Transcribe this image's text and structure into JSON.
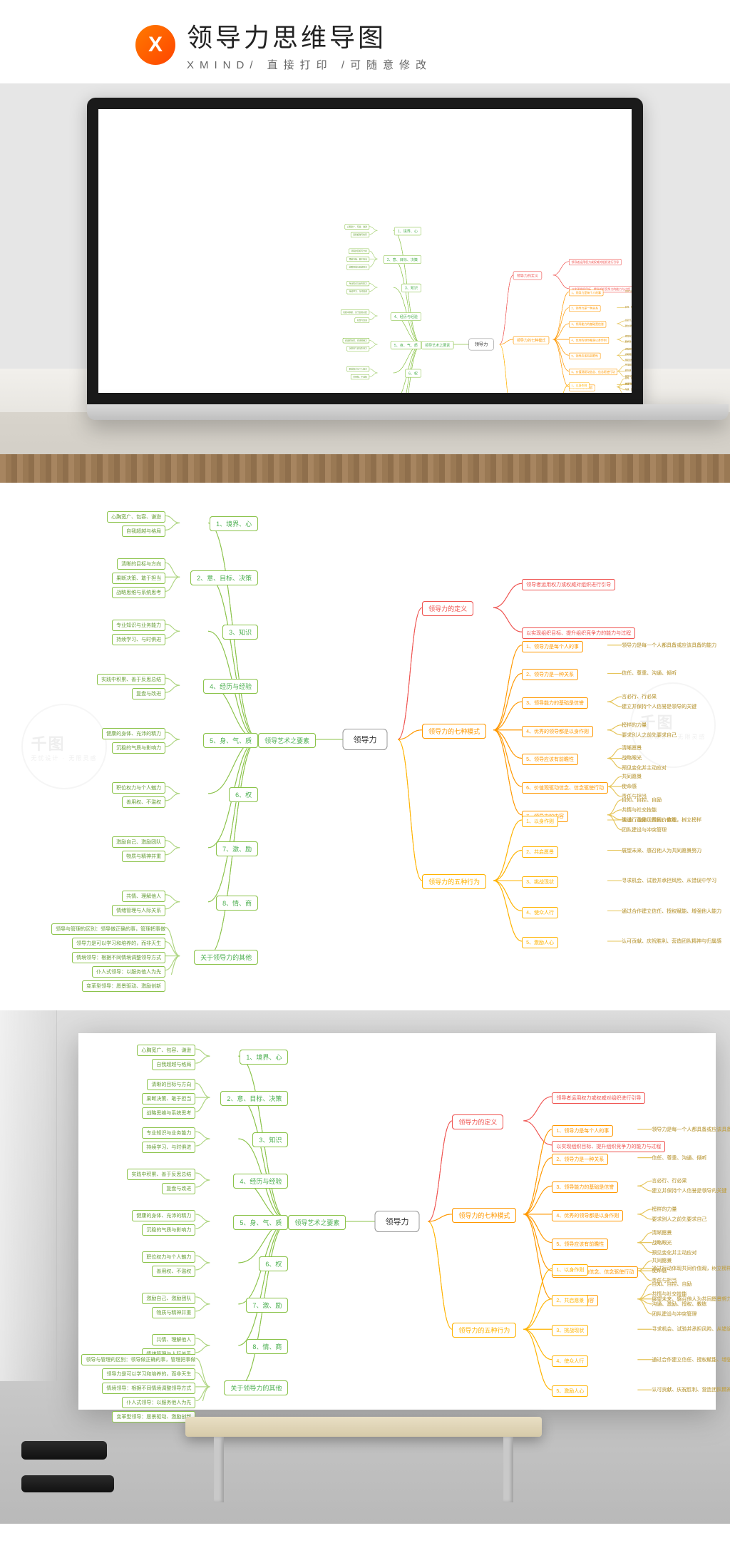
{
  "header": {
    "logo_letter": "X",
    "title": "领导力思维导图",
    "subtitle": "XMIND/  直接打印  /可随意修改"
  },
  "watermark": {
    "brand": "千图",
    "slogan": "无忧设计 · 无限灵感"
  },
  "mindmap": {
    "center": "领导力",
    "left_root": "领导艺术之要素",
    "right_branches": [
      {
        "label": "领导力的定义",
        "color": "red",
        "children": [
          "领导者运用权力或权威对组织进行引导",
          "以实现组织目标、提升组织竞争力的能力与过程"
        ]
      },
      {
        "label": "领导力的七种模式",
        "color": "orange",
        "children": [
          {
            "label": "1、领导力是每个人的事",
            "children": [
              "领导力是每一个人都具备或应该具备的能力"
            ]
          },
          {
            "label": "2、领导力是一种关系",
            "children": [
              "信任、尊重、沟通、倾听"
            ]
          },
          {
            "label": "3、领导能力的基础是信誉",
            "children": [
              "言必行、行必果",
              "建立并保持个人信誉是领导的关键"
            ]
          },
          {
            "label": "4、优秀的领导都是以身作则",
            "children": [
              "榜样的力量",
              "要求别人之前先要求自己"
            ]
          },
          {
            "label": "5、领导应该有前瞻性",
            "children": [
              "清晰愿景",
              "战略眼光",
              "预见变化并主动应对"
            ]
          },
          {
            "label": "6、价值观驱动信念、信念驱使行动",
            "children": [
              "共同愿景",
              "使命感",
              "责任与担当"
            ]
          },
          {
            "label": "7、领导力的内容",
            "children": [
              "自知、自控、自励",
              "共情与社交技能",
              "沟通、激励、授权、教练",
              "团队建设与冲突管理"
            ]
          }
        ]
      },
      {
        "label": "领导力的五种行为",
        "color": "amber",
        "children": [
          {
            "label": "1、以身作则",
            "children": [
              "通过行动体现共同价值观，树立榜样"
            ]
          },
          {
            "label": "2、共启愿景",
            "children": [
              "展望未来、感召他人为共同愿景努力"
            ]
          },
          {
            "label": "3、挑战现状",
            "children": [
              "寻求机会、试验并承担风险、从错误中学习"
            ]
          },
          {
            "label": "4、使众人行",
            "children": [
              "通过合作建立信任、授权赋能、增强他人能力"
            ]
          },
          {
            "label": "5、激励人心",
            "children": [
              "认可贡献、庆祝胜利、营造团队精神与归属感"
            ]
          }
        ]
      }
    ],
    "left_branches": [
      {
        "label": "1、境界、心",
        "children": [
          "心胸宽广、包容、谦逊",
          "自我超越与格局"
        ]
      },
      {
        "label": "2、意、目标、决策",
        "children": [
          "清晰的目标与方向",
          "果断决策、敢于担当",
          "战略思维与系统思考"
        ]
      },
      {
        "label": "3、知识",
        "children": [
          "专业知识与业务能力",
          "持续学习、与时俱进"
        ]
      },
      {
        "label": "4、经历与经验",
        "children": [
          "实践中积累、善于反思总结",
          "复盘与改进"
        ]
      },
      {
        "label": "5、身、气、质",
        "children": [
          "健康的身体、充沛的精力",
          "沉稳的气质与影响力"
        ]
      },
      {
        "label": "6、权",
        "children": [
          "职位权力与个人魅力",
          "善用权、不滥权"
        ]
      },
      {
        "label": "7、激、励",
        "children": [
          "激励自己、激励团队",
          "物质与精神并重"
        ]
      },
      {
        "label": "8、情、商",
        "children": [
          "共情、理解他人",
          "情绪管理与人际关系"
        ]
      },
      {
        "label": "关于领导力的其他",
        "children": [
          "领导与管理的区别：领导做正确的事，管理把事做正确",
          "领导力是可以学习和培养的，而非天生",
          "情境领导：根据不同情境调整领导方式",
          "仆人式领导：以服务他人为先",
          "变革型领导：愿景驱动、激励创新"
        ]
      }
    ]
  }
}
